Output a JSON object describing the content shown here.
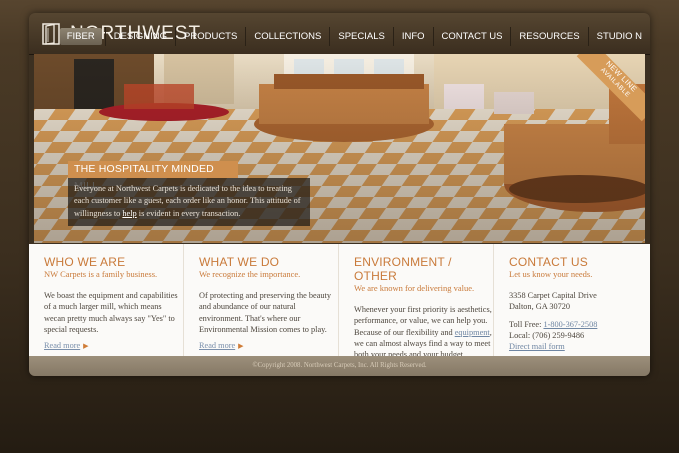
{
  "brand": {
    "name": "NORTHWEST"
  },
  "nav": {
    "items": [
      {
        "label": "FIBER",
        "active": true
      },
      {
        "label": "DESIGNING"
      },
      {
        "label": "PRODUCTS"
      },
      {
        "label": "COLLECTIONS"
      },
      {
        "label": "SPECIALS"
      },
      {
        "label": "INFO"
      },
      {
        "label": "CONTACT US"
      },
      {
        "label": "RESOURCES"
      },
      {
        "label": "STUDIO N"
      }
    ]
  },
  "hero": {
    "banner": "THE HOSPITALITY MINDED MILL",
    "text_before": "Everyone at Northwest Carpets is dedicated to the idea to treating each customer like a guest, each order like an honor. This attitude of willingness to ",
    "text_link": "help",
    "text_after": " is evident in every transaction.",
    "ribbon_line1": "NEW LINE",
    "ribbon_line2": "AVAILABLE"
  },
  "columns": [
    {
      "title": "WHO WE ARE",
      "subtitle": "NW Carpets is a family business.",
      "body": "We boast the equipment and capabilities of a much larger mill, which means wecan pretty much always say \"Yes\" to special requests.",
      "more": "Read more"
    },
    {
      "title": "WHAT WE DO",
      "subtitle": "We recognize the importance.",
      "body": "Of protecting and preserving the beauty and abundance of our natural environment. That's where our Environmental Mission comes to play.",
      "more": "Read more"
    },
    {
      "title": "ENVIRONMENT / OTHER",
      "subtitle": "We are known for delivering value.",
      "body_before": "Whenever your first priority is aesthetics, performance, or value, we can help you. Because of our flexibility and ",
      "body_link": "equipment",
      "body_after": ", we can almost always find a way to meet both your needs and your budget."
    },
    {
      "title": "CONTACT US",
      "subtitle": "Let us know your needs.",
      "address1": "3358 Carpet Capital Drive",
      "address2": "Dalton, GA 30720",
      "tollfree_label": "Toll Free: ",
      "tollfree": "1-800-367-2508",
      "local": "Local: (706) 259-9486",
      "mail_link": "Direct mail form"
    }
  ],
  "footer": {
    "copyright": "©Copyright 2008. Northwest Carpets, Inc. All Rights Reserved."
  },
  "colors": {
    "accent": "#c97a3a",
    "link": "#6f86a3",
    "header": "#3b2e1f"
  }
}
